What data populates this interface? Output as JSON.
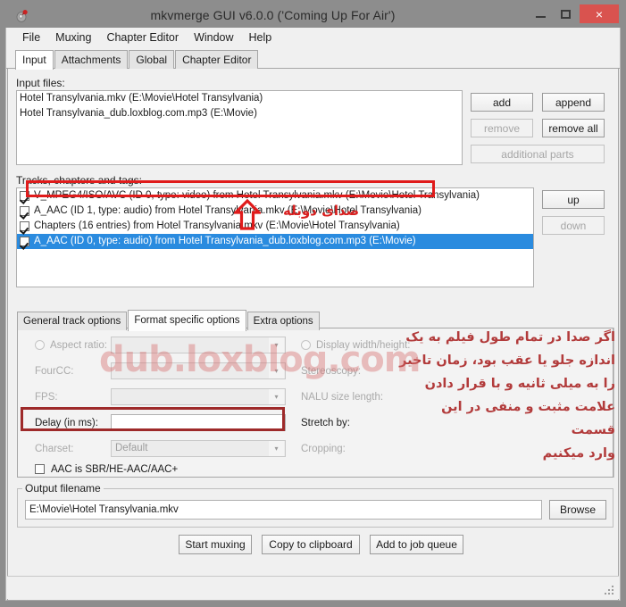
{
  "window": {
    "title": "mkvmerge GUI v6.0.0 ('Coming Up For Air')",
    "app_icon": "mkvmerge-icon",
    "minimize_label": "—",
    "maximize_label": "□",
    "close_label": "×",
    "close_color": "#d9534f"
  },
  "menubar": {
    "items": [
      {
        "label": "File"
      },
      {
        "label": "Muxing"
      },
      {
        "label": "Chapter Editor"
      },
      {
        "label": "Window"
      },
      {
        "label": "Help"
      }
    ]
  },
  "main_tabs": [
    {
      "label": "Input",
      "active": true
    },
    {
      "label": "Attachments",
      "active": false
    },
    {
      "label": "Global",
      "active": false
    },
    {
      "label": "Chapter Editor",
      "active": false
    }
  ],
  "input_files": {
    "label": "Input files:",
    "rows": [
      "Hotel Transylvania.mkv (E:\\Movie\\Hotel Transylvania)",
      "Hotel Transylvania_dub.loxblog.com.mp3 (E:\\Movie)"
    ],
    "buttons": [
      {
        "label": "add",
        "disabled": false
      },
      {
        "label": "append",
        "disabled": false
      },
      {
        "label": "remove",
        "disabled": true
      },
      {
        "label": "remove all",
        "disabled": false
      },
      {
        "label": "additional parts",
        "disabled": true
      }
    ]
  },
  "tracks": {
    "label": "Tracks, chapters and tags:",
    "rows": [
      {
        "checked": true,
        "selected": false,
        "text": "V_MPEG4/ISO/AVC (ID 0, type: video) from Hotel Transylvania.mkv (E:\\Movie\\Hotel Transylvania)"
      },
      {
        "checked": true,
        "selected": false,
        "text": "A_AAC (ID 1, type: audio) from Hotel Transylvania.mkv (E:\\Movie\\Hotel Transylvania)"
      },
      {
        "checked": true,
        "selected": false,
        "text": "Chapters (16 entries) from Hotel Transylvania.mkv (E:\\Movie\\Hotel Transylvania)"
      },
      {
        "checked": true,
        "selected": true,
        "text": "A_AAC (ID 0, type: audio) from Hotel Transylvania_dub.loxblog.com.mp3 (E:\\Movie)"
      }
    ],
    "buttons": [
      {
        "label": "up",
        "disabled": false
      },
      {
        "label": "down",
        "disabled": true
      }
    ],
    "selection_color": "#2a8bdf"
  },
  "annotations": {
    "dub_audio_note": "صدای دوبله",
    "arrow_icon": "arrow-up-icon",
    "delay_note_lines": [
      "اگر صدا در تمام طول فیلم به یک",
      "اندازه جلو یا عقب بود، زمان تاخیر",
      "را به میلی ثانیه و با قرار دادن",
      "علامت مثبت و منفی در این قسمت",
      "وارد میکنیم"
    ],
    "highlight_color": "#9e2a2a",
    "selection_highlight_color": "#e01b1b"
  },
  "watermark": "dub.loxblog.com",
  "inner_tabs": [
    {
      "label": "General track options",
      "active": false
    },
    {
      "label": "Format specific options",
      "active": true
    },
    {
      "label": "Extra options",
      "active": false
    }
  ],
  "format_options": {
    "aspect_ratio": {
      "label": "Aspect ratio:",
      "value": "",
      "enabled": false
    },
    "display_width_height": {
      "label": "Display width/height:",
      "value": "",
      "enabled": false
    },
    "fourcc": {
      "label": "FourCC:",
      "value": "",
      "enabled": false
    },
    "stereoscopy": {
      "label": "Stereoscopy:",
      "value": "",
      "enabled": false
    },
    "fps": {
      "label": "FPS:",
      "value": "",
      "enabled": false
    },
    "nalu_size_length": {
      "label": "NALU size length:",
      "value": "",
      "enabled": false
    },
    "delay": {
      "label": "Delay (in ms):",
      "value": "",
      "enabled": true
    },
    "stretch_by": {
      "label": "Stretch by:",
      "value": "",
      "enabled": true
    },
    "charset": {
      "label": "Charset:",
      "value": "Default",
      "enabled": false
    },
    "cropping": {
      "label": "Cropping:",
      "value": "",
      "enabled": false
    },
    "aac_sbr": {
      "label": "AAC is SBR/HE-AAC/AAC+",
      "checked": false
    }
  },
  "output": {
    "legend": "Output filename",
    "value": "E:\\Movie\\Hotel Transylvania.mkv",
    "browse_label": "Browse"
  },
  "action_buttons": [
    {
      "label": "Start muxing"
    },
    {
      "label": "Copy to clipboard"
    },
    {
      "label": "Add to job queue"
    }
  ],
  "statusbar": {
    "text": "",
    "grip_icon": "resize-grip-icon"
  }
}
